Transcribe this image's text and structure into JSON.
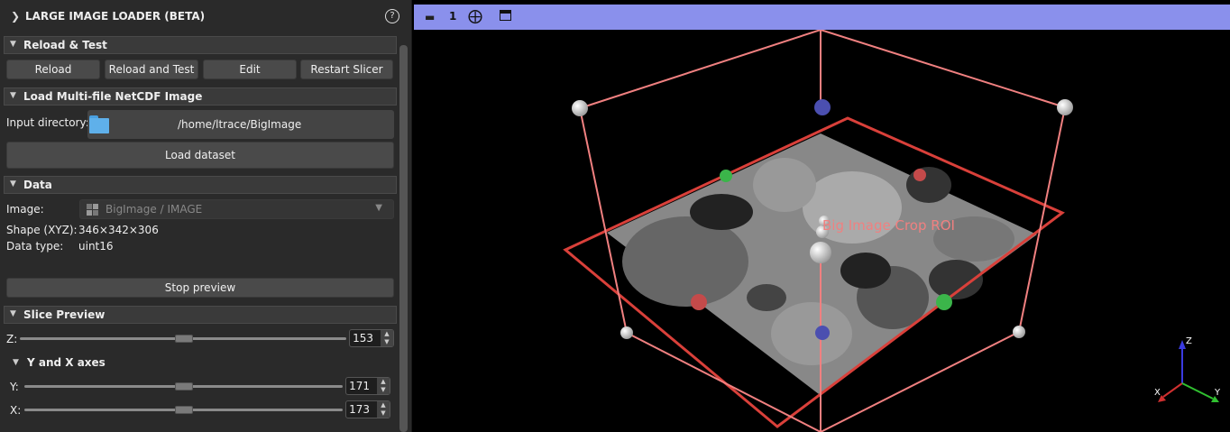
{
  "module": {
    "title": "LARGE IMAGE LOADER (BETA)",
    "help": "?"
  },
  "reload_section": {
    "title": "Reload & Test",
    "buttons": [
      "Reload",
      "Reload and Test",
      "Edit",
      "Restart Slicer"
    ]
  },
  "load_section": {
    "title": "Load Multi-file NetCDF Image",
    "input_label": "Input directory:",
    "input_path": "/home/ltrace/BigImage",
    "load_button": "Load dataset"
  },
  "data_section": {
    "title": "Data",
    "image_label": "Image:",
    "image_value": "BigImage / IMAGE",
    "shape_label": "Shape (XYZ):",
    "shape_value": "346×342×306",
    "dtype_label": "Data type:",
    "dtype_value": "uint16",
    "stop_button": "Stop preview"
  },
  "slice_section": {
    "title": "Slice Preview",
    "z_label": "Z:",
    "z_value": "153",
    "yx_title": "Y and X axes",
    "y_label": "Y:",
    "y_value": "171",
    "x_label": "X:",
    "x_value": "173"
  },
  "view": {
    "toolbar_number": "1",
    "roi_label": "Big Image Crop ROI",
    "axes": {
      "x": "X",
      "y": "Y",
      "z": "Z"
    },
    "colors": {
      "roi": "#f08080",
      "frame": "#d9403a",
      "toolbar": "#8a90ec"
    }
  }
}
